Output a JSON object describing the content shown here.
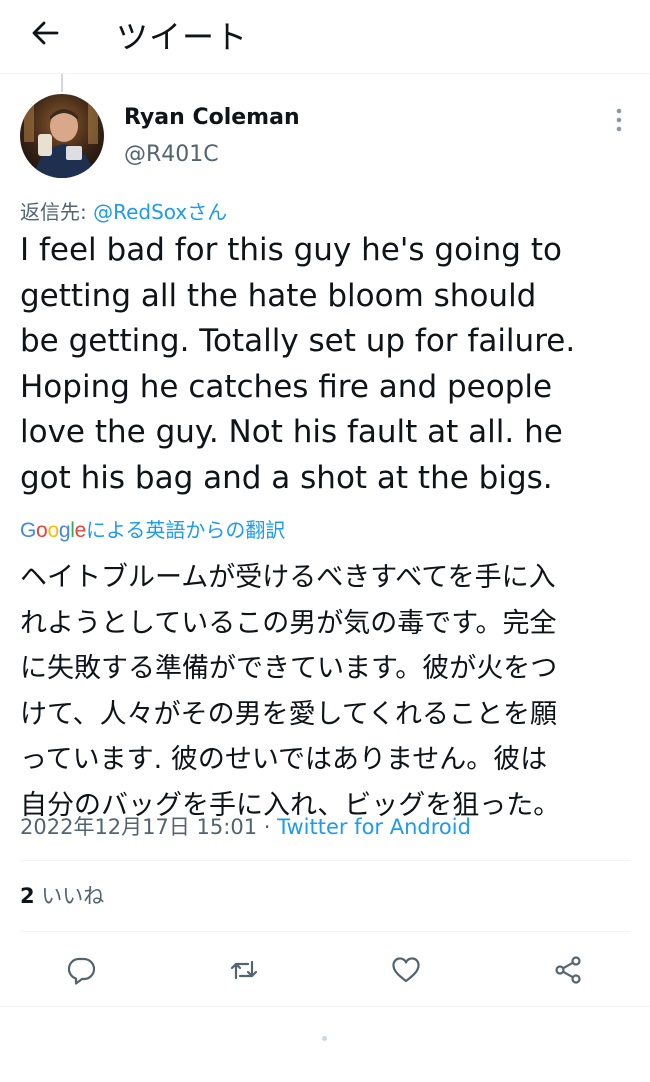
{
  "header": {
    "back_icon": "arrow-left-icon",
    "title": "ツイート"
  },
  "tweet": {
    "author": {
      "display_name": "Ryan Coleman",
      "handle": "@R401C",
      "avatar": "user-photo"
    },
    "more_icon": "more-vertical-icon",
    "reply_to": {
      "prefix": "返信先: ",
      "mention": "@RedSoxさん"
    },
    "text_lines": [
      "I feel bad for this guy he's going to",
      "getting all the hate bloom should",
      "be getting. Totally set up for failure.",
      "Hoping he catches fire and people",
      "love the guy. Not his fault at all. he",
      "got his bag and a shot at the bigs."
    ],
    "translation": {
      "provider": "Google",
      "label": "による英語からの翻訳",
      "lines": [
        "ヘイトブルームが受けるべきすべてを手に入",
        "れようとしているこの男が気の毒です。完全",
        "に失敗する準備ができています。彼が火をつ",
        "けて、人々がその男を愛してくれることを願",
        "っています. 彼のせいではありません。彼は",
        "自分のバッグを手に入れ、ビッグを狙った。"
      ]
    },
    "timestamp": "2022年12月17日 15:01",
    "separator": " · ",
    "source": "Twitter for Android",
    "likes": {
      "count": "2",
      "label": " いいね"
    },
    "actions": {
      "reply_icon": "reply-icon",
      "retweet_icon": "retweet-icon",
      "like_icon": "heart-icon",
      "share_icon": "share-icon"
    }
  },
  "colors": {
    "accent": "#1d9bf0",
    "text_primary": "#0f1419",
    "text_secondary": "#536471",
    "divider": "#eff3f4"
  }
}
